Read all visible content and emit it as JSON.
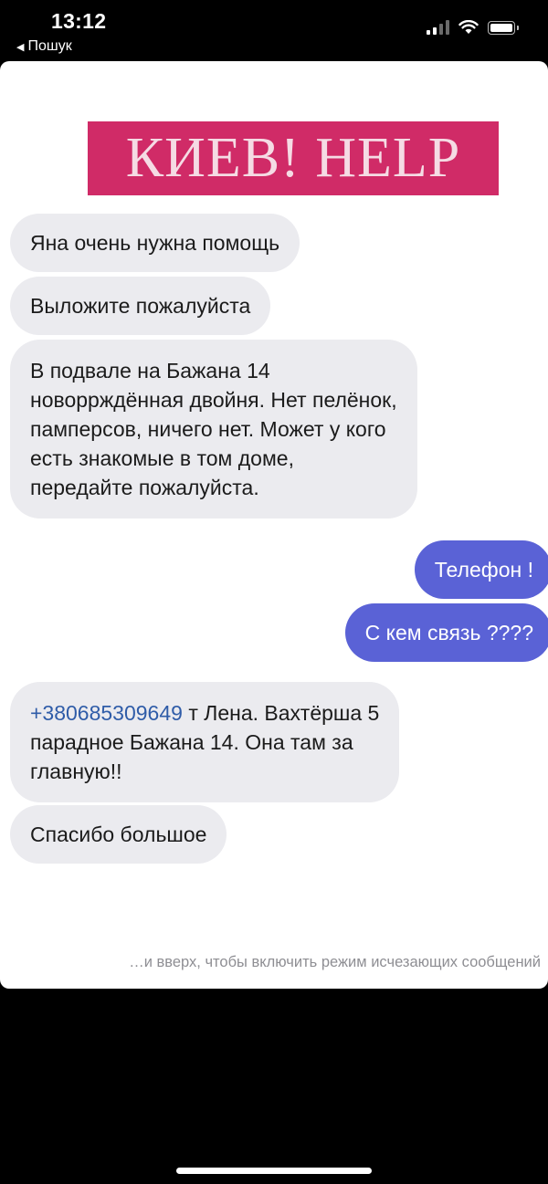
{
  "status_bar": {
    "time": "13:12",
    "back_label": "Пошук",
    "back_arrow": "◀"
  },
  "banner": {
    "text": "КИЕВ! HELP",
    "color": "#d02b67"
  },
  "messages": [
    {
      "direction": "incoming",
      "text": "Яна очень нужна помощь"
    },
    {
      "direction": "incoming",
      "text": "Выложите пожалуйста"
    },
    {
      "direction": "incoming",
      "lines": [
        "В подвале на Бажана 14",
        "новоррждённая двойня. Нет пелёнок,",
        "памперсов, ничего нет. Может у кого",
        "есть знакомые в том доме,",
        "передайте пожалуйста."
      ]
    },
    {
      "direction": "outgoing",
      "text": "Телефон !"
    },
    {
      "direction": "outgoing",
      "text": "С кем связь ????"
    },
    {
      "direction": "incoming",
      "phone": "+380685309649",
      "line1_rest": " т Лена. Вахтёрша 5",
      "line2": "парадное Бажана 14. Она там за",
      "line3": "главную!!"
    },
    {
      "direction": "incoming",
      "text": "Спасибо большое"
    }
  ],
  "footer_hint": "…и вверх, чтобы включить режим исчезающих сообщений",
  "colors": {
    "incoming_bubble": "#ebebef",
    "outgoing_bubble": "#5a62d6",
    "link": "#2f5ca8"
  }
}
